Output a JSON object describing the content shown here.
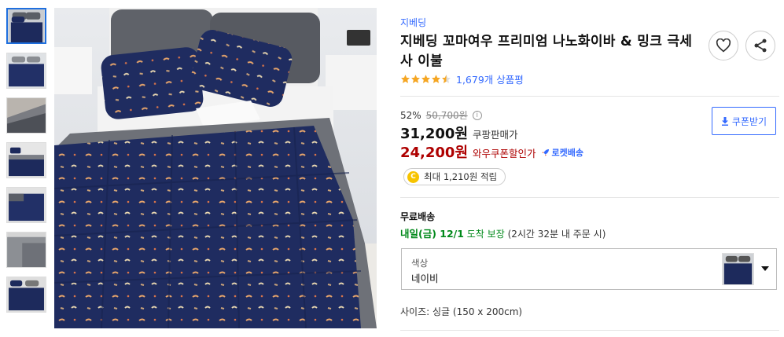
{
  "thumbnails": [
    {
      "name": "thumb-1",
      "active": true
    },
    {
      "name": "thumb-2",
      "active": false
    },
    {
      "name": "thumb-3",
      "active": false
    },
    {
      "name": "thumb-4",
      "active": false
    },
    {
      "name": "thumb-5",
      "active": false
    },
    {
      "name": "thumb-6",
      "active": false
    },
    {
      "name": "thumb-7",
      "active": false
    }
  ],
  "product": {
    "brand": "지베딩",
    "title": "지베딩 꼬마여우 프리미엄 나노화이바 & 밍크 극세사 이불",
    "rating": 4.5,
    "review_count": "1,679개 상품평"
  },
  "price": {
    "discount_rate": "52%",
    "original": "50,700원",
    "info_symbol": "i",
    "sale": "31,200원",
    "sale_label": "쿠팡판매가",
    "wow": "24,200원",
    "wow_label": "와우쿠폰할인가",
    "rocket_label": "로켓배송",
    "coupon_button": "쿠폰받기",
    "points_coin": "C",
    "points": "최대 1,210원 적립"
  },
  "shipping": {
    "title": "무료배송",
    "date": "내일(금) 12/1",
    "arrive": "도착 보장",
    "condition": "(2시간 32분 내 주문 시)"
  },
  "option": {
    "label": "색상",
    "value": "네이비"
  },
  "size": {
    "label": "사이즈:",
    "value": "싱글 (150 x 200cm)"
  },
  "colors": {
    "accent": "#346aff",
    "price_red": "#ae0000",
    "ship_green": "#00891a",
    "star": "#f5a623",
    "navy": "#1d2a5c"
  },
  "icons": {
    "heart": "heart-icon",
    "share": "share-icon",
    "download": "download-icon",
    "rocket": "rocket-icon",
    "coin": "coin-icon",
    "caret": "caret-down-icon",
    "star": "star-icon"
  }
}
